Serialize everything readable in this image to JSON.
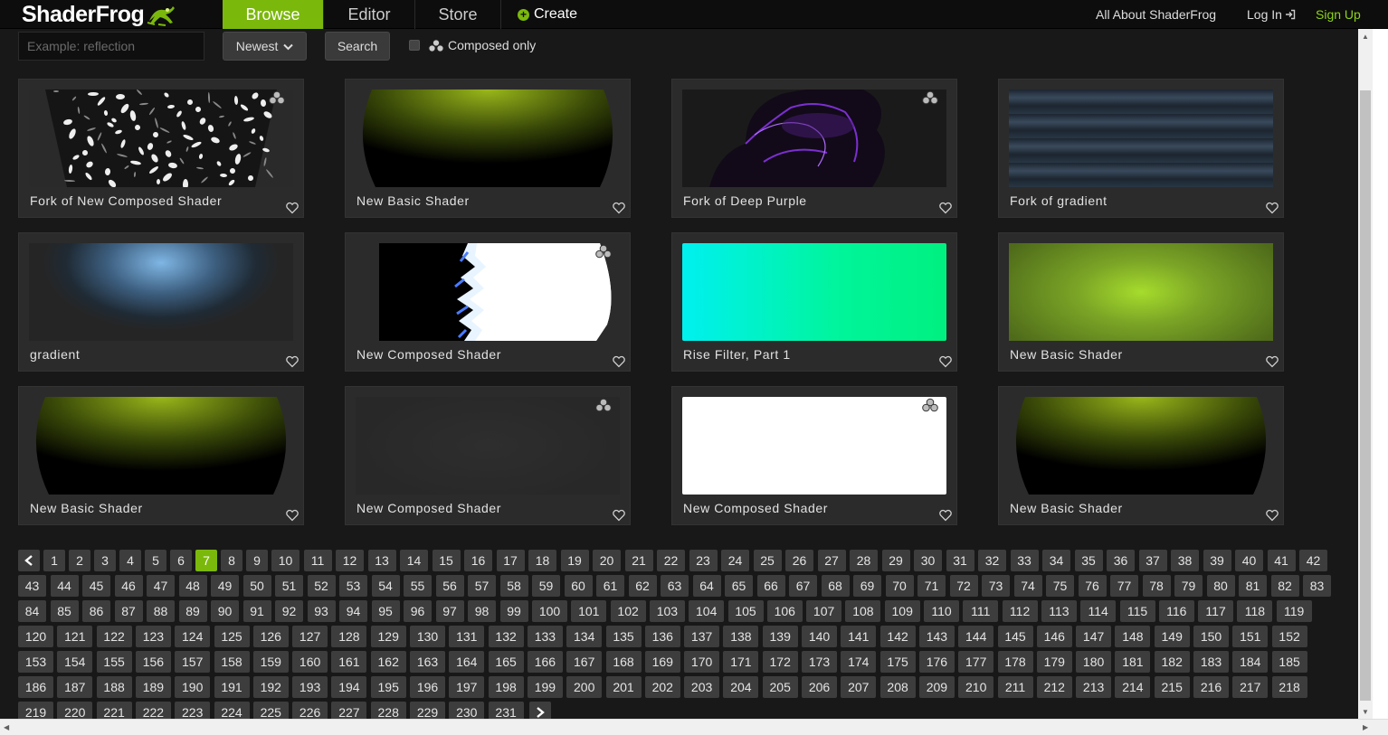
{
  "brand": {
    "name": "ShaderFrog",
    "accent": "#7bb80c"
  },
  "nav": {
    "tabs": [
      {
        "label": "Browse",
        "active": true
      },
      {
        "label": "Editor",
        "active": false
      },
      {
        "label": "Store",
        "active": false
      }
    ],
    "create": "Create",
    "about": "All About ShaderFrog",
    "login": "Log In",
    "signup": "Sign Up"
  },
  "search": {
    "placeholder": "Example: reflection",
    "sort": "Newest",
    "button": "Search",
    "composed_only": "Composed only"
  },
  "shaders": [
    {
      "title": "Fork of New Composed Shader",
      "composed": true,
      "thumb": "sparkle"
    },
    {
      "title": "New Basic Shader",
      "composed": false,
      "thumb": "green-dome"
    },
    {
      "title": "Fork of Deep Purple",
      "composed": true,
      "thumb": "purple"
    },
    {
      "title": "Fork of gradient",
      "composed": false,
      "thumb": "stripes"
    },
    {
      "title": "gradient",
      "composed": false,
      "thumb": "blue-glow"
    },
    {
      "title": "New Composed Shader",
      "composed": true,
      "thumb": "flame"
    },
    {
      "title": "Rise Filter, Part 1",
      "composed": false,
      "thumb": "cyan-green"
    },
    {
      "title": "New Basic Shader",
      "composed": false,
      "thumb": "green-radial"
    },
    {
      "title": "New Basic Shader",
      "composed": false,
      "thumb": "green-dome"
    },
    {
      "title": "New Composed Shader",
      "composed": true,
      "thumb": "dark"
    },
    {
      "title": "New Composed Shader",
      "composed": true,
      "thumb": "white"
    },
    {
      "title": "New Basic Shader",
      "composed": false,
      "thumb": "green-dome"
    }
  ],
  "pagination": {
    "current": 7,
    "total": 231,
    "prev": "‹",
    "next": "›"
  }
}
